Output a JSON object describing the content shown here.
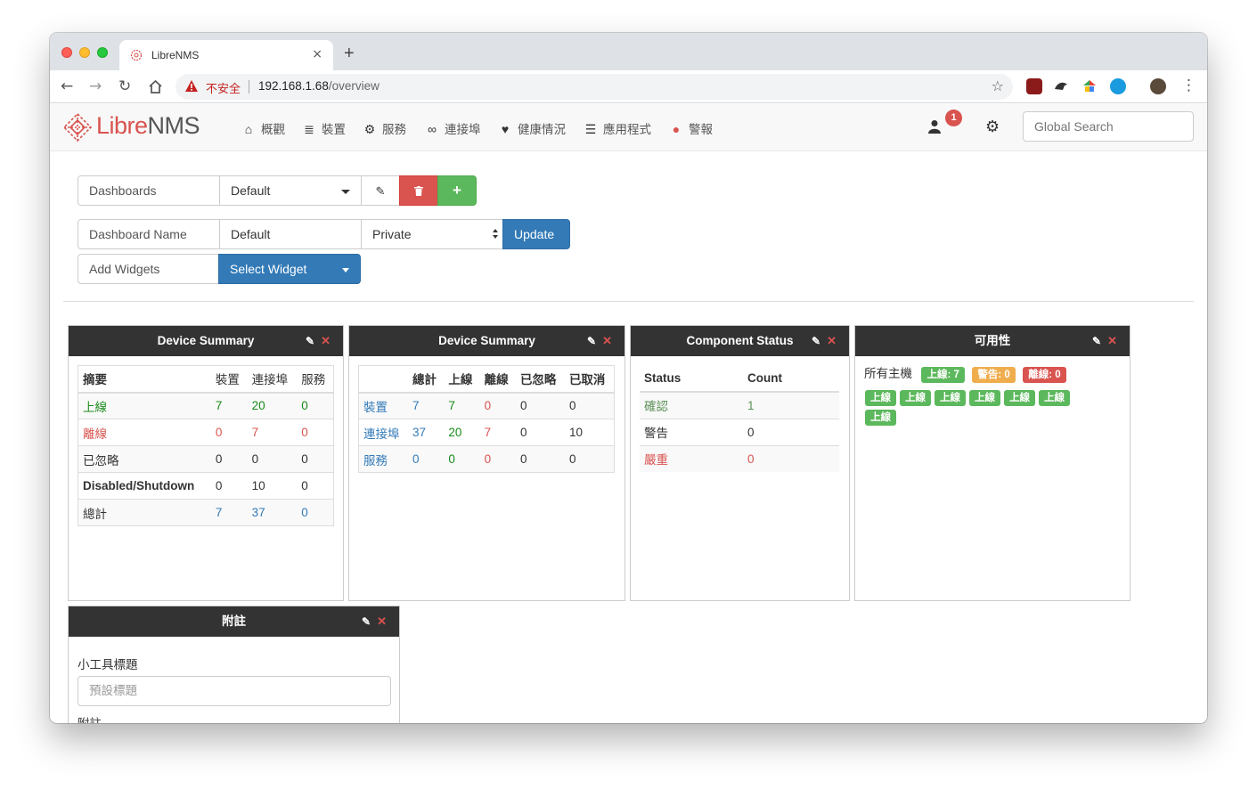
{
  "browser": {
    "tab_title": "LibreNMS",
    "tab_close": "×",
    "new_tab": "+",
    "insecure_label": "不安全",
    "url_host": "192.168.1.68",
    "url_path": "/overview"
  },
  "navbar": {
    "brand_libre": "Libre",
    "brand_nms": "NMS",
    "menu": [
      {
        "label": "概觀",
        "icon": "home-icon"
      },
      {
        "label": "裝置",
        "icon": "server-icon"
      },
      {
        "label": "服務",
        "icon": "cogs-icon"
      },
      {
        "label": "連接埠",
        "icon": "link-icon"
      },
      {
        "label": "健康情況",
        "icon": "heartbeat-icon"
      },
      {
        "label": "應用程式",
        "icon": "tasks-icon"
      },
      {
        "label": "警報",
        "icon": "exclamation-circle-icon"
      }
    ],
    "notification_count": "1",
    "search_placeholder": "Global Search"
  },
  "dashboard": {
    "dashboards_label": "Dashboards",
    "selected_dashboard": "Default",
    "name_label": "Dashboard Name",
    "name_value": "Default",
    "access_value": "Private",
    "update_label": "Update",
    "add_widgets_label": "Add Widgets",
    "select_widget_label": "Select Widget"
  },
  "widgets": {
    "summary1": {
      "title": "Device Summary",
      "headers": [
        "摘要",
        "裝置",
        "連接埠",
        "服務"
      ],
      "rows": [
        [
          "上線",
          "7",
          "20",
          "0"
        ],
        [
          "離線",
          "0",
          "7",
          "0"
        ],
        [
          "已忽略",
          "0",
          "0",
          "0"
        ],
        [
          "Disabled/Shutdown",
          "0",
          "10",
          "0"
        ],
        [
          "總計",
          "7",
          "37",
          "0"
        ]
      ]
    },
    "summary2": {
      "title": "Device Summary",
      "headers": [
        "",
        "總計",
        "上線",
        "離線",
        "已忽略",
        "已取消"
      ],
      "rows": [
        [
          "裝置",
          "7",
          "7",
          "0",
          "0",
          "0"
        ],
        [
          "連接埠",
          "37",
          "20",
          "7",
          "0",
          "10"
        ],
        [
          "服務",
          "0",
          "0",
          "0",
          "0",
          "0"
        ]
      ]
    },
    "component": {
      "title": "Component Status",
      "headers": [
        "Status",
        "Count"
      ],
      "rows": [
        [
          "確認",
          "1"
        ],
        [
          "警告",
          "0"
        ],
        [
          "嚴重",
          "0"
        ]
      ]
    },
    "availability": {
      "title": "可用性",
      "all_hosts": "所有主機",
      "up": "上線: 7",
      "warn": "警告: 0",
      "down": "離線: 0",
      "host_labels": [
        "上線",
        "上線",
        "上線",
        "上線",
        "上線",
        "上線",
        "上線"
      ]
    },
    "notes": {
      "title": "附註",
      "widget_title_label": "小工具標題",
      "widget_title_placeholder": "預設標題",
      "notes_label": "附註"
    }
  },
  "colors": {
    "danger": "#d9534f",
    "success": "#5cb85c",
    "primary": "#337ab7",
    "warning": "#f0ad4e"
  }
}
